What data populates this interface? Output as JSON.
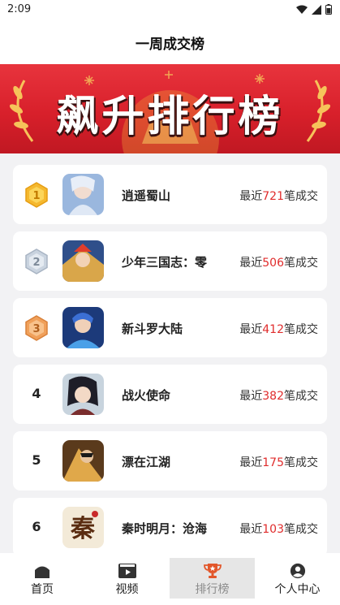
{
  "status": {
    "time": "2:09"
  },
  "header": {
    "title": "一周成交榜"
  },
  "banner": {
    "title": "飙升排行榜"
  },
  "deal_prefix": "最近",
  "deal_suffix": "笔成交",
  "games": [
    {
      "rank": "1",
      "name": "逍遥蜀山",
      "count": "721",
      "badge": "gold"
    },
    {
      "rank": "2",
      "name": "少年三国志：零",
      "count": "506",
      "badge": "silver"
    },
    {
      "rank": "3",
      "name": "新斗罗大陆",
      "count": "412",
      "badge": "bronze"
    },
    {
      "rank": "4",
      "name": "战火使命",
      "count": "382",
      "badge": ""
    },
    {
      "rank": "5",
      "name": "漂在江湖",
      "count": "175",
      "badge": ""
    },
    {
      "rank": "6",
      "name": "秦时明月：沧海",
      "count": "103",
      "badge": ""
    }
  ],
  "tabs": [
    {
      "label": "首页",
      "icon": "home-icon"
    },
    {
      "label": "视频",
      "icon": "video-icon"
    },
    {
      "label": "排行榜",
      "icon": "trophy-icon",
      "active": true
    },
    {
      "label": "个人中心",
      "icon": "user-icon"
    }
  ],
  "colors": {
    "banner": "#d8202b",
    "deal_count": "#e02c2c",
    "active_tab": "#e6e6e6",
    "trophy": "#e2572b"
  }
}
